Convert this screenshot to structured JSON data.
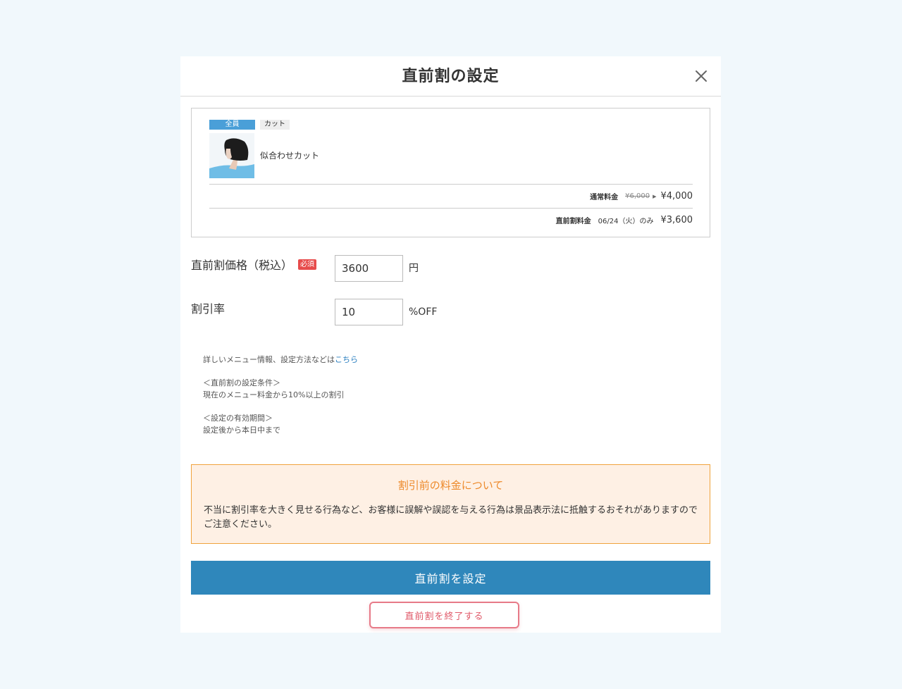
{
  "modal": {
    "title": "直前割の設定",
    "close_icon": "close-icon"
  },
  "menu": {
    "tag_all": "全員",
    "tag_category": "カット",
    "name": "似合わせカット",
    "thumbnail_icon": "menu-photo",
    "regular": {
      "label": "通常料金",
      "old_price": "¥6,000",
      "new_price": "¥4,000"
    },
    "lastminute": {
      "label": "直前割料金",
      "date": "06/24（火）のみ",
      "price": "¥3,600"
    }
  },
  "form": {
    "price_label": "直前割価格（税込）",
    "required_badge": "必須",
    "price_value": "3600",
    "price_unit": "円",
    "rate_label": "割引率",
    "rate_value": "10",
    "rate_unit": "%OFF"
  },
  "info": {
    "line1_prefix": "詳しいメニュー情報、設定方法などは",
    "line1_link": "こちら",
    "condition_title": "＜直前割の設定条件＞",
    "condition_body": "現在のメニュー料金から10%以上の割引",
    "period_title": "＜設定の有効期間＞",
    "period_body": "設定後から本日中まで"
  },
  "notice": {
    "title": "割引前の料金について",
    "body": "不当に割引率を大きく見せる行為など、お客様に誤解や誤認を与える行為は景品表示法に抵触するおそれがありますのでご注意ください。"
  },
  "actions": {
    "submit": "直前割を設定",
    "end": "直前割を終了する"
  },
  "colors": {
    "primary": "#2f87bb",
    "danger": "#e05a6a",
    "warning": "#ed8a2b",
    "tag_blue": "#4a9fd8"
  }
}
